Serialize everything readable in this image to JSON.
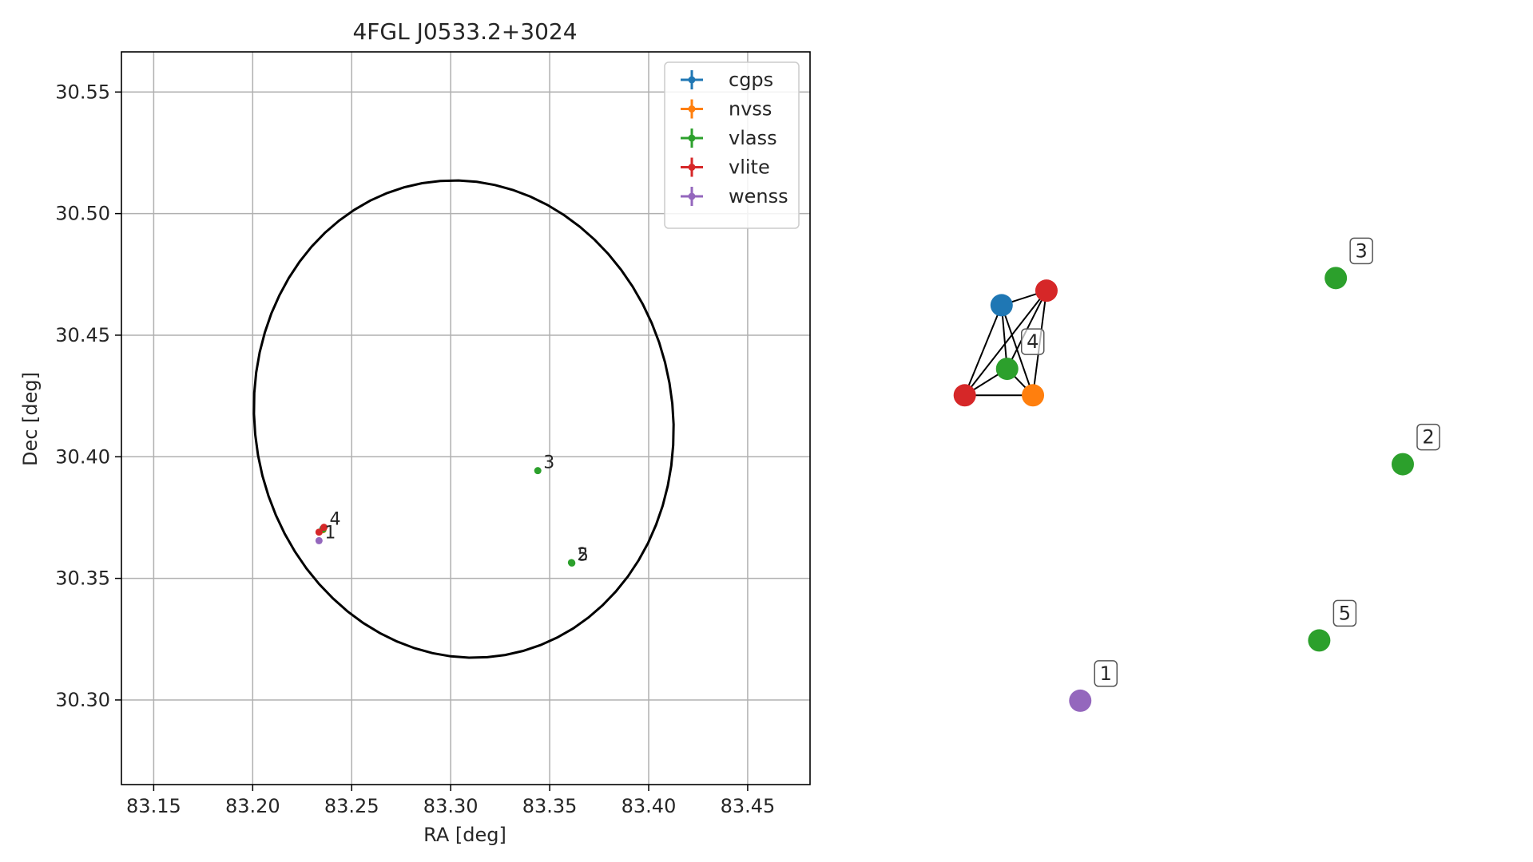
{
  "chart_data": [
    {
      "type": "scatter",
      "title": "4FGL J0533.2+3024",
      "xlabel": "RA [deg]",
      "ylabel": "Dec [deg]",
      "xlim": [
        83.1337,
        83.4815
      ],
      "ylim": [
        30.2652,
        30.5665
      ],
      "x_ticks": [
        83.15,
        83.2,
        83.25,
        83.3,
        83.35,
        83.4,
        83.45
      ],
      "x_tick_labels": [
        "83.15",
        "83.20",
        "83.25",
        "83.30",
        "83.35",
        "83.40",
        "83.45"
      ],
      "y_ticks": [
        30.3,
        30.35,
        30.4,
        30.45,
        30.5,
        30.55
      ],
      "y_tick_labels": [
        "30.30",
        "30.35",
        "30.40",
        "30.45",
        "30.50",
        "30.55"
      ],
      "grid": true,
      "legend_position": "top-right",
      "ellipse": {
        "center_ra": 83.3066,
        "center_dec": 30.4155,
        "semi_ra": 0.1055,
        "semi_dec": 0.0985,
        "tilt_deg": -10
      },
      "series": [
        {
          "name": "cgps",
          "color": "#1f77b4",
          "points": [
            {
              "ra": 83.2355,
              "dec": 30.3705
            }
          ]
        },
        {
          "name": "nvss",
          "color": "#ff7f0e",
          "points": [
            {
              "ra": 83.2355,
              "dec": 30.37
            }
          ]
        },
        {
          "name": "vlass",
          "color": "#2ca02c",
          "points": [
            {
              "ra": 83.2355,
              "dec": 30.3702
            },
            {
              "ra": 83.344,
              "dec": 30.3943
            },
            {
              "ra": 83.361,
              "dec": 30.3565
            },
            {
              "ra": 83.3612,
              "dec": 30.3563
            }
          ]
        },
        {
          "name": "vlite",
          "color": "#d62728",
          "points": [
            {
              "ra": 83.236,
              "dec": 30.371
            },
            {
              "ra": 83.2335,
              "dec": 30.369
            }
          ]
        },
        {
          "name": "wenss",
          "color": "#9467bd",
          "points": [
            {
              "ra": 83.2335,
              "dec": 30.3655
            }
          ]
        }
      ],
      "annotations": [
        {
          "text": "4",
          "ra": 83.236,
          "dec": 30.371
        },
        {
          "text": "1",
          "ra": 83.2335,
          "dec": 30.3655
        },
        {
          "text": "3",
          "ra": 83.344,
          "dec": 30.3943
        },
        {
          "text": "5",
          "ra": 83.3612,
          "dec": 30.3563
        },
        {
          "text": "2",
          "ra": 83.361,
          "dec": 30.3565
        }
      ]
    },
    {
      "type": "scatter",
      "subtype": "network-graph",
      "axes": "off",
      "view": {
        "x": [
          0,
          100
        ],
        "y": [
          0,
          100
        ]
      },
      "nodes": [
        {
          "id": "cgps-1",
          "catalog": "cgps",
          "color": "#1f77b4",
          "x": 13.5,
          "y": 72.0
        },
        {
          "id": "vlite-1",
          "catalog": "vlite",
          "color": "#d62728",
          "x": 20.8,
          "y": 74.2
        },
        {
          "id": "vlass-4",
          "catalog": "vlass",
          "color": "#2ca02c",
          "x": 14.4,
          "y": 62.4
        },
        {
          "id": "vlite-2",
          "catalog": "vlite",
          "color": "#d62728",
          "x": 7.5,
          "y": 58.4
        },
        {
          "id": "nvss-1",
          "catalog": "nvss",
          "color": "#ff7f0e",
          "x": 18.6,
          "y": 58.4
        },
        {
          "id": "vlass-3",
          "catalog": "vlass",
          "color": "#2ca02c",
          "x": 67.9,
          "y": 76.1
        },
        {
          "id": "vlass-2",
          "catalog": "vlass",
          "color": "#2ca02c",
          "x": 78.8,
          "y": 48.0
        },
        {
          "id": "vlass-5",
          "catalog": "vlass",
          "color": "#2ca02c",
          "x": 65.2,
          "y": 21.4
        },
        {
          "id": "wenss-1",
          "catalog": "wenss",
          "color": "#9467bd",
          "x": 26.3,
          "y": 12.3
        }
      ],
      "edges": [
        [
          "cgps-1",
          "vlite-1"
        ],
        [
          "cgps-1",
          "vlite-2"
        ],
        [
          "cgps-1",
          "vlass-4"
        ],
        [
          "cgps-1",
          "nvss-1"
        ],
        [
          "vlite-1",
          "vlass-4"
        ],
        [
          "vlite-1",
          "vlite-2"
        ],
        [
          "vlite-1",
          "nvss-1"
        ],
        [
          "vlass-4",
          "vlite-2"
        ],
        [
          "vlass-4",
          "nvss-1"
        ],
        [
          "vlite-2",
          "nvss-1"
        ]
      ],
      "labels": [
        {
          "text": "4",
          "node": "vlass-4"
        },
        {
          "text": "3",
          "node": "vlass-3"
        },
        {
          "text": "2",
          "node": "vlass-2"
        },
        {
          "text": "5",
          "node": "vlass-5"
        },
        {
          "text": "1",
          "node": "wenss-1"
        }
      ]
    }
  ]
}
